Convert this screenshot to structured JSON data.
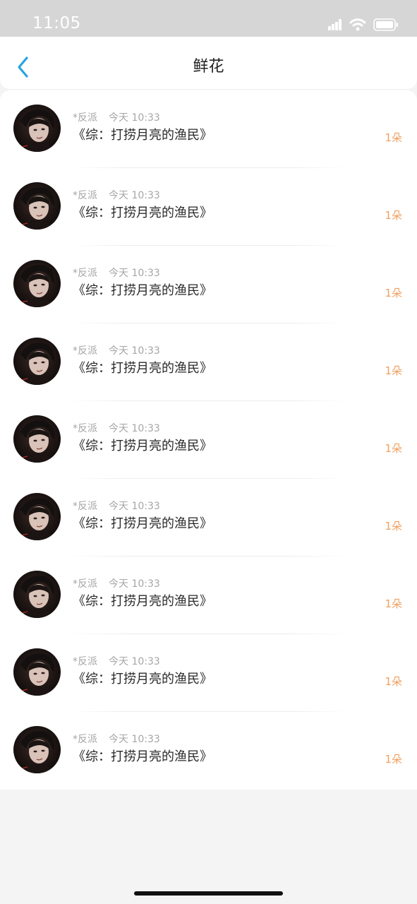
{
  "status_bar": {
    "time": "11:05",
    "icons": [
      "signal-icon",
      "wifi-icon",
      "battery-icon"
    ]
  },
  "header": {
    "title": "鲜花",
    "back_icon": "chevron-left-icon"
  },
  "colors": {
    "accent_blue": "#2aa3e0",
    "count_orange": "#f0a062",
    "meta_gray": "#a6a6a6"
  },
  "flowers": [
    {
      "user": "*反派",
      "time": "今天 10:33",
      "title": "《综：打捞月亮的渔民》",
      "count": "1朵"
    },
    {
      "user": "*反派",
      "time": "今天 10:33",
      "title": "《综：打捞月亮的渔民》",
      "count": "1朵"
    },
    {
      "user": "*反派",
      "time": "今天 10:33",
      "title": "《综：打捞月亮的渔民》",
      "count": "1朵"
    },
    {
      "user": "*反派",
      "time": "今天 10:33",
      "title": "《综：打捞月亮的渔民》",
      "count": "1朵"
    },
    {
      "user": "*反派",
      "time": "今天 10:33",
      "title": "《综：打捞月亮的渔民》",
      "count": "1朵"
    },
    {
      "user": "*反派",
      "time": "今天 10:33",
      "title": "《综：打捞月亮的渔民》",
      "count": "1朵"
    },
    {
      "user": "*反派",
      "time": "今天 10:33",
      "title": "《综：打捞月亮的渔民》",
      "count": "1朵"
    },
    {
      "user": "*反派",
      "time": "今天 10:33",
      "title": "《综：打捞月亮的渔民》",
      "count": "1朵"
    },
    {
      "user": "*反派",
      "time": "今天 10:33",
      "title": "《综：打捞月亮的渔民》",
      "count": "1朵"
    }
  ]
}
